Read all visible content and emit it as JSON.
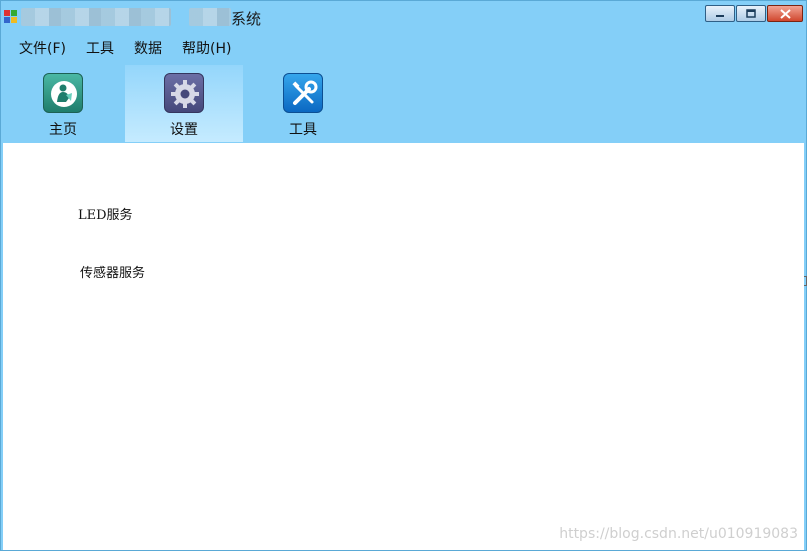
{
  "window": {
    "title": "系统",
    "controls": [
      "minimize-icon",
      "maximize-icon",
      "close-icon"
    ]
  },
  "menu": {
    "items": [
      {
        "label": "文件(F)"
      },
      {
        "label": "工具"
      },
      {
        "label": "数据"
      },
      {
        "label": "帮助(H)"
      }
    ]
  },
  "toolbar": {
    "items": [
      {
        "label": "主页",
        "icon": "home-user-icon",
        "active": false
      },
      {
        "label": "设置",
        "icon": "gear-icon",
        "active": true
      },
      {
        "label": "工具",
        "icon": "wrench-screwdriver-icon",
        "active": false
      }
    ]
  },
  "content": {
    "services": [
      {
        "label": "LED服务"
      },
      {
        "label": "传感器服务"
      }
    ]
  },
  "watermark": "https://blog.csdn.net/u010919083",
  "colors": {
    "window_bg": "#84cff8",
    "active_tab": "#c5ebff",
    "content_bg": "#ffffff"
  }
}
